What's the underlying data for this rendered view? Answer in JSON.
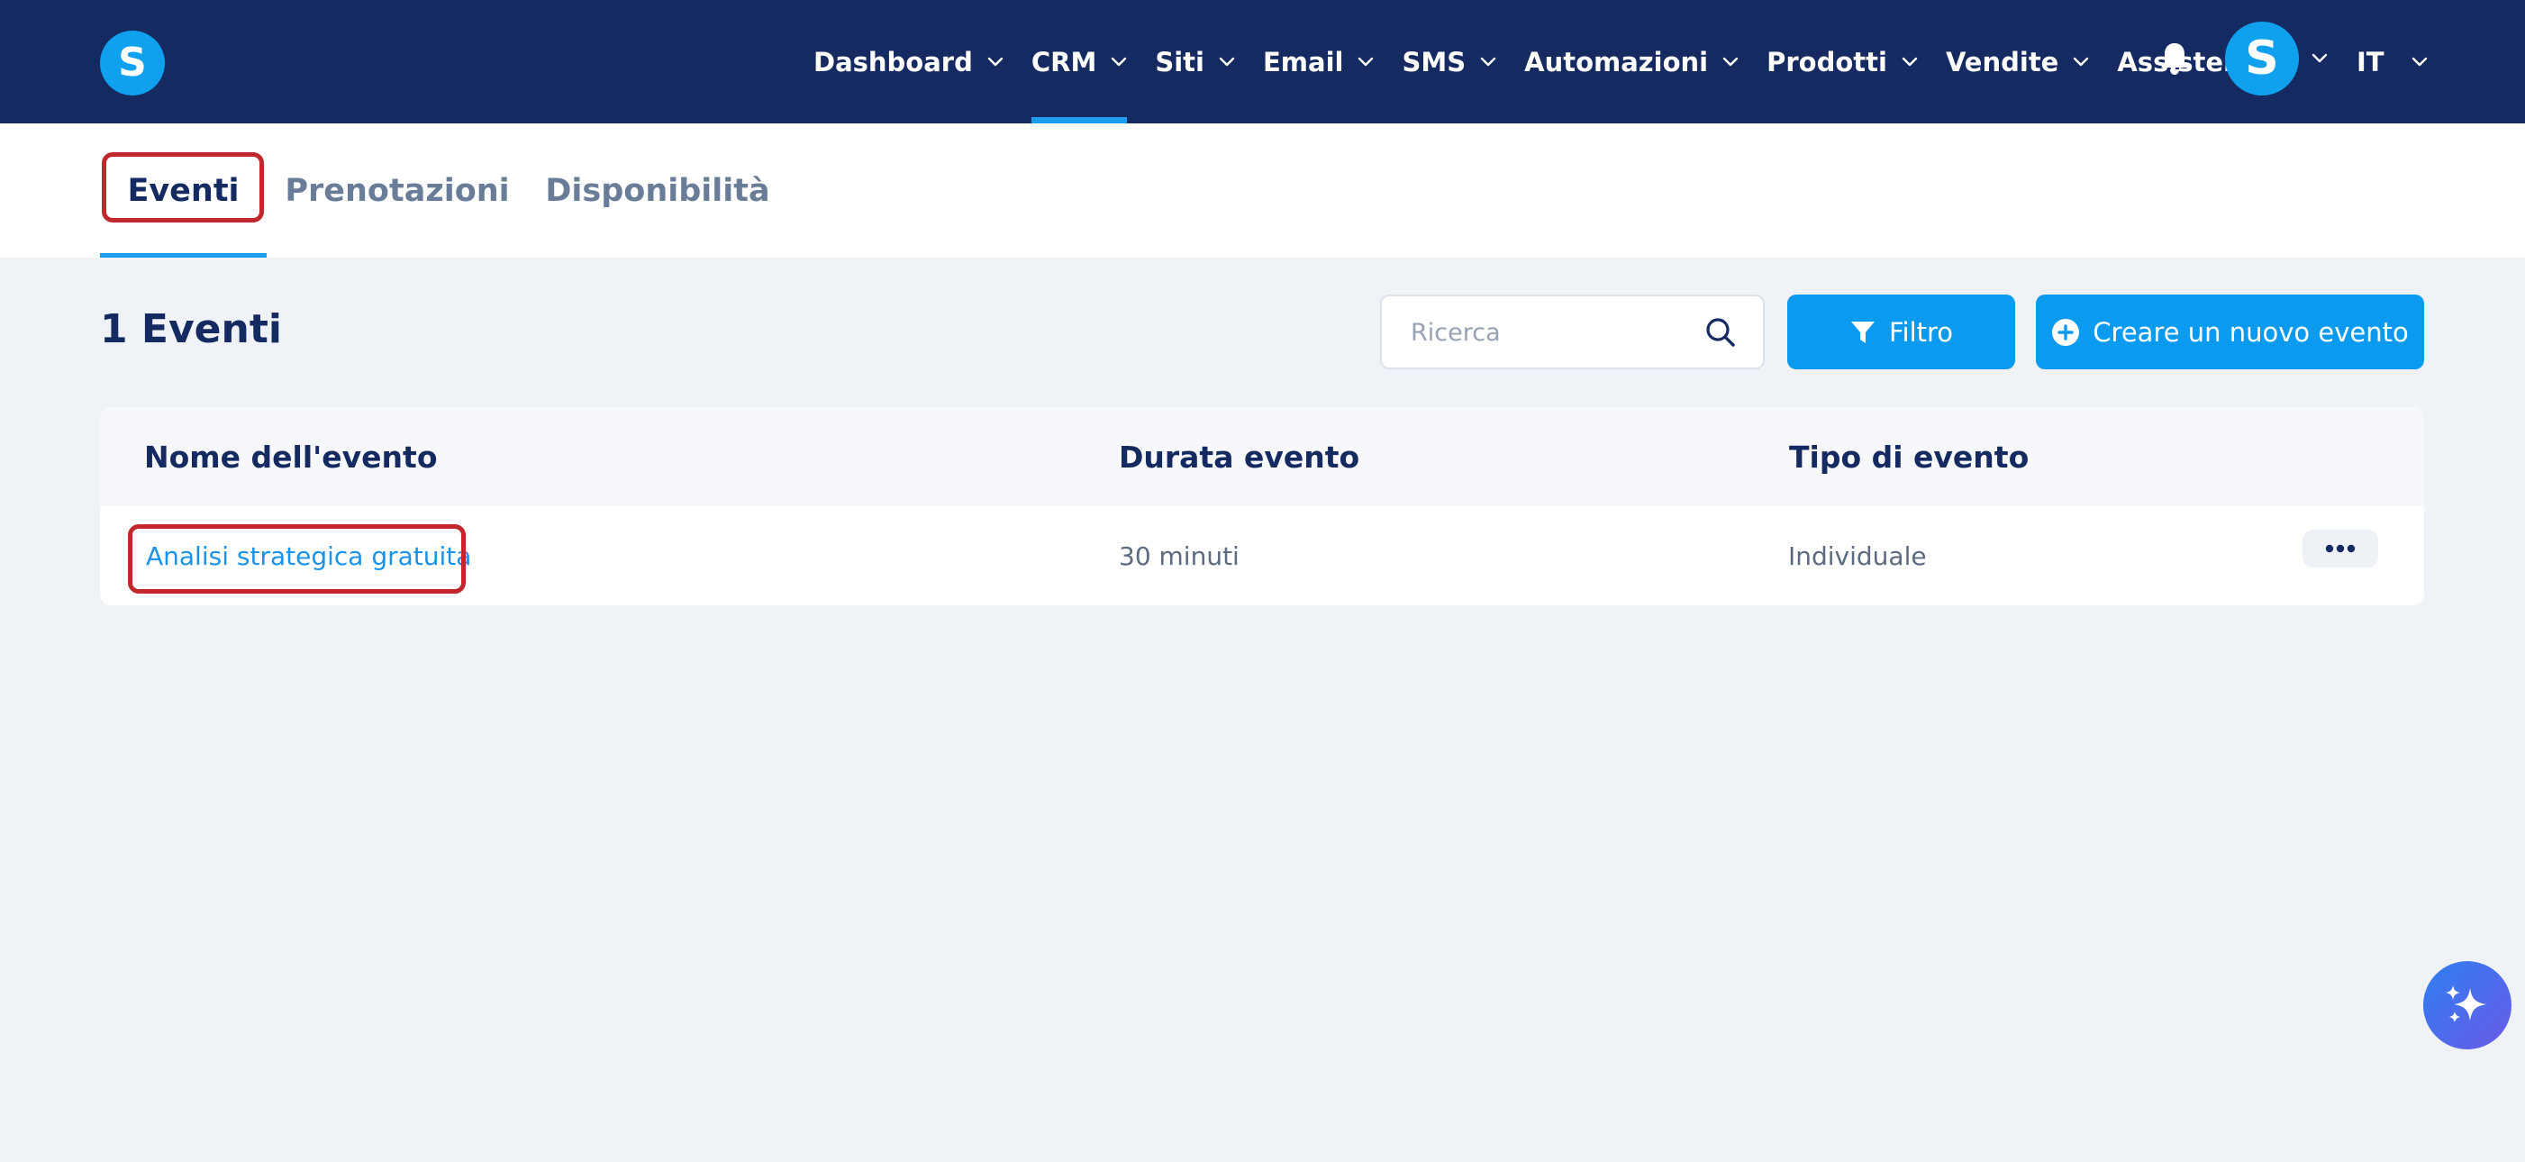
{
  "navbar": {
    "logo_letter": "S",
    "items": [
      {
        "label": "Dashboard",
        "active": false
      },
      {
        "label": "CRM",
        "active": true
      },
      {
        "label": "Siti",
        "active": false
      },
      {
        "label": "Email",
        "active": false
      },
      {
        "label": "SMS",
        "active": false
      },
      {
        "label": "Automazioni",
        "active": false
      },
      {
        "label": "Prodotti",
        "active": false
      },
      {
        "label": "Vendite",
        "active": false
      },
      {
        "label": "Assistenza",
        "active": false
      }
    ],
    "avatar_letter": "S",
    "language": "IT"
  },
  "tabs": [
    {
      "label": "Eventi",
      "active": true
    },
    {
      "label": "Prenotazioni",
      "active": false
    },
    {
      "label": "Disponibilità",
      "active": false
    }
  ],
  "toolbar": {
    "count_title": "1 Eventi",
    "search_placeholder": "Ricerca",
    "filter_label": "Filtro",
    "create_label": "Creare un nuovo evento"
  },
  "table": {
    "headers": [
      "Nome dell'evento",
      "Durata evento",
      "Tipo di evento"
    ],
    "rows": [
      {
        "name": "Analisi strategica gratuita",
        "duration": "30 minuti",
        "type": "Individuale"
      }
    ]
  },
  "colors": {
    "navbar_bg": "#142a60",
    "accent": "#0a9af0",
    "highlight": "#c2272d"
  },
  "icons": {
    "bell": "bell-icon",
    "search": "search-icon",
    "filter": "filter-icon",
    "create": "plus-circle-icon",
    "more": "more-horizontal-icon",
    "assistant": "sparkles-icon"
  }
}
